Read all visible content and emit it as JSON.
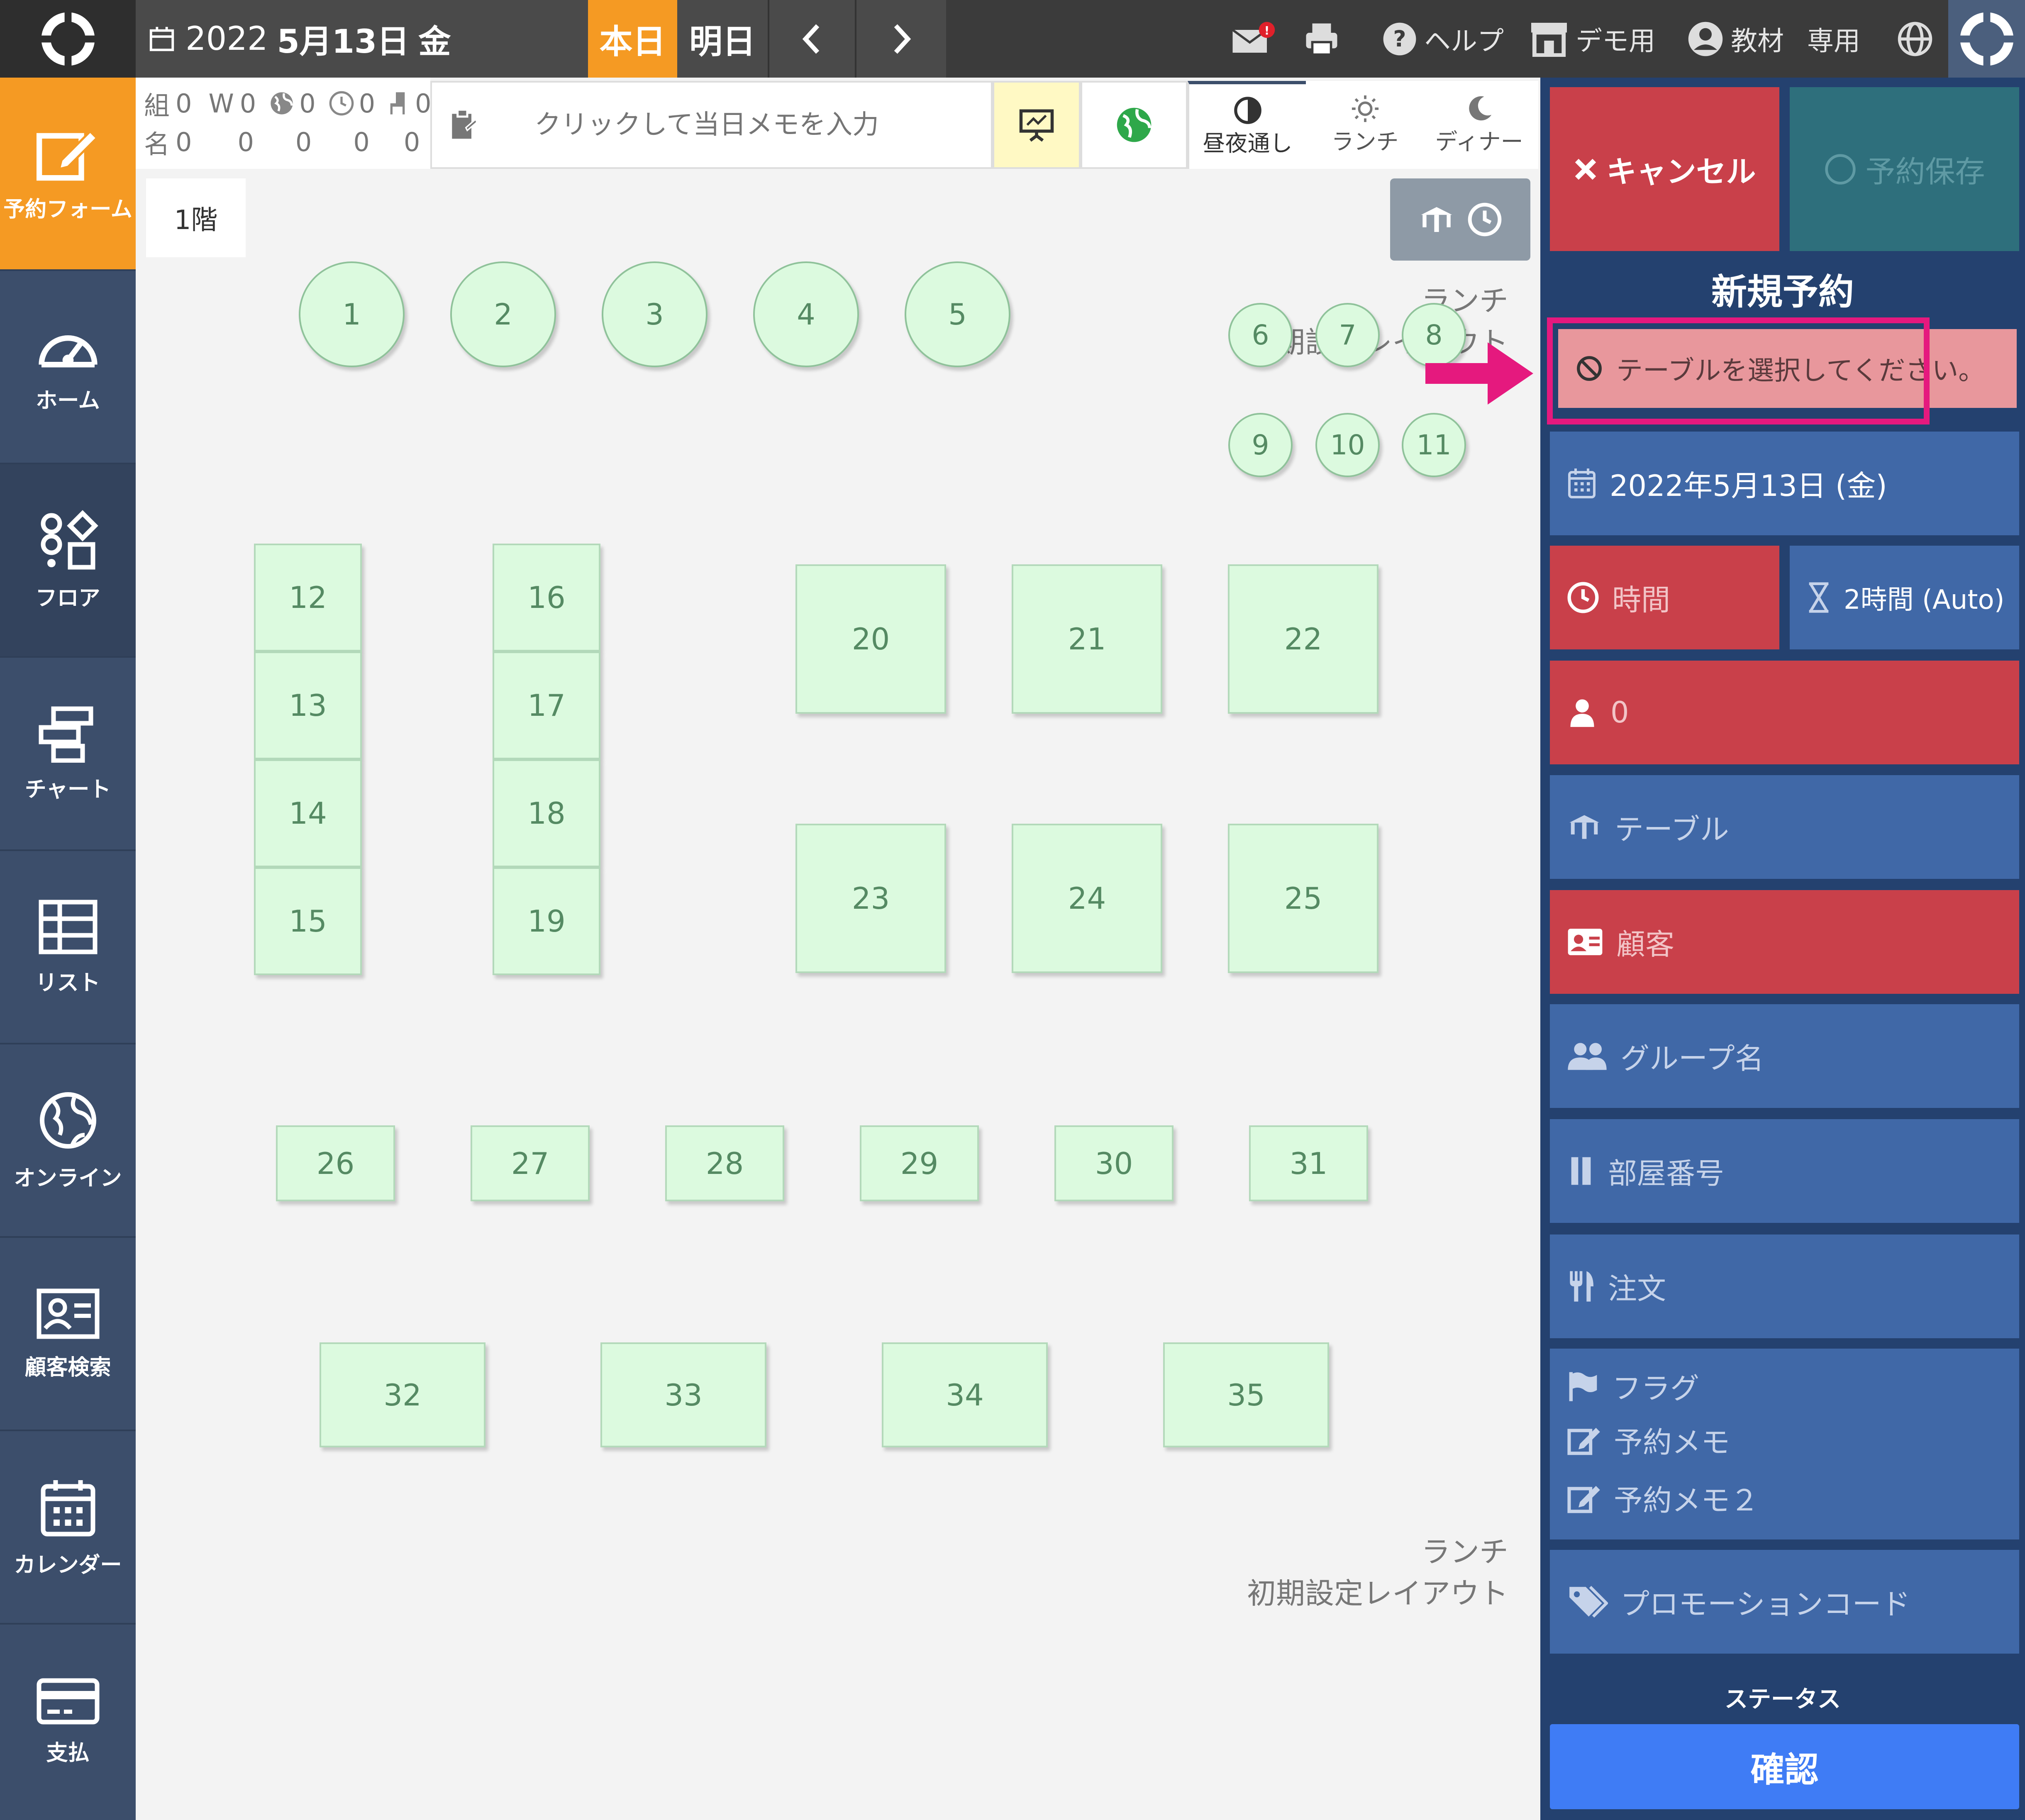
{
  "topbar": {
    "date_year": "2022",
    "date_month_day": "5月13日",
    "date_weekday": "金",
    "today_label": "本日",
    "tomorrow_label": "明日",
    "help_label": "ヘルプ",
    "demo_label": "デモ用",
    "teaching_label": "教材",
    "exclusive_label": "専用"
  },
  "sidebar": {
    "items": [
      {
        "label": "予約フォーム",
        "icon": "edit-icon"
      },
      {
        "label": "ホーム",
        "icon": "dashboard-icon"
      },
      {
        "label": "フロア",
        "icon": "floor-icon"
      },
      {
        "label": "チャート",
        "icon": "chart-icon"
      },
      {
        "label": "リスト",
        "icon": "list-icon"
      },
      {
        "label": "オンライン",
        "icon": "globe-icon"
      },
      {
        "label": "顧客検索",
        "icon": "customer-card-icon"
      },
      {
        "label": "カレンダー",
        "icon": "calendar-icon"
      },
      {
        "label": "支払",
        "icon": "credit-card-icon"
      }
    ]
  },
  "counts": {
    "row1": [
      "組",
      "0",
      "W",
      "0",
      "0",
      "0",
      "0"
    ],
    "row2": [
      "名",
      "0",
      "0",
      "0",
      "0",
      "0"
    ]
  },
  "memo": {
    "placeholder": "クリックして当日メモを入力"
  },
  "periods": [
    "昼夜通し",
    "ランチ",
    "ディナー"
  ],
  "floor": {
    "tab": "1階",
    "layout_label_top": [
      "ランチ",
      "初期設定レイアウト"
    ],
    "layout_label_bottom": [
      "ランチ",
      "初期設定レイアウト"
    ]
  },
  "tables": {
    "round_large": [
      "1",
      "2",
      "3",
      "4",
      "5"
    ],
    "round_small": [
      "6",
      "7",
      "8",
      "9",
      "10",
      "11"
    ],
    "col_a": [
      "12",
      "13",
      "14",
      "15"
    ],
    "col_b": [
      "16",
      "17",
      "18",
      "19"
    ],
    "big_top": [
      "20",
      "21",
      "22"
    ],
    "big_bottom": [
      "23",
      "24",
      "25"
    ],
    "row_small": [
      "26",
      "27",
      "28",
      "29",
      "30",
      "31"
    ],
    "row_wide": [
      "32",
      "33",
      "34",
      "35"
    ]
  },
  "panel": {
    "cancel_label": "キャンセル",
    "save_label": "予約保存",
    "title": "新規予約",
    "warning": "テーブルを選択してください。",
    "date": "2022年5月13日 (金)",
    "time_label": "時間",
    "duration_label": "2時間 (Auto)",
    "guests": "0",
    "table_label": "テーブル",
    "customer_label": "顧客",
    "group_label": "グループ名",
    "room_label": "部屋番号",
    "order_label": "注文",
    "flag_label": "フラグ",
    "memo_label": "予約メモ",
    "memo2_label": "予約メモ２",
    "promo_label": "プロモーションコード",
    "status_label": "ステータス",
    "confirm_label": "確認"
  },
  "colors": {
    "accent_orange": "#f59a23",
    "panel_blue": "#4068a7",
    "panel_red": "#c9404a",
    "highlight_pink": "#e5197e",
    "table_green": "#dcfadf"
  }
}
